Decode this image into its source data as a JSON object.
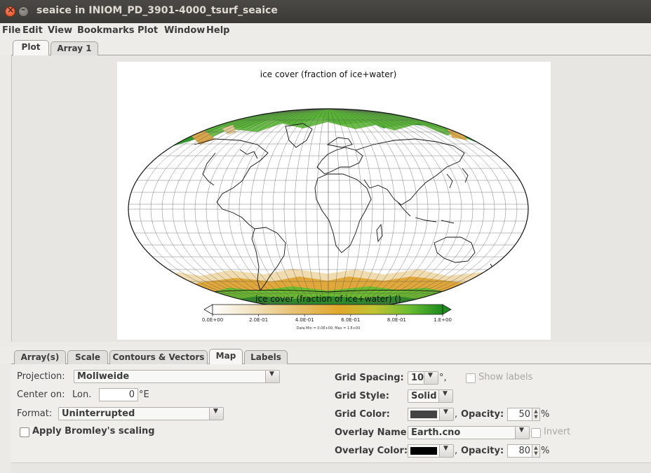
{
  "window": {
    "title": "seaice in INIOM_PD_3901-4000_tsurf_seaice"
  },
  "menu": [
    "File",
    "Edit",
    "View",
    "Bookmarks",
    "Plot",
    "Window",
    "Help"
  ],
  "top_tabs": [
    "Plot",
    "Array 1"
  ],
  "plot": {
    "title": "ice cover (fraction of ice+water)",
    "colorbar": {
      "label": "ice cover (fraction of ice+water) ()",
      "ticks": [
        "0.0E+00",
        "2.0E-01",
        "4.0E-01",
        "6.0E-01",
        "8.0E-01",
        "1.E+00"
      ],
      "stats": "Data Min = 0.0E+00, Max = 1.E+00",
      "colors": [
        "#ffffff",
        "#f0e0c0",
        "#e8c070",
        "#e0a530",
        "#c8c030",
        "#70c030",
        "#1e8c1e"
      ]
    }
  },
  "lower_tabs": [
    "Array(s)",
    "Scale",
    "Contours & Vectors",
    "Map",
    "Labels"
  ],
  "map_settings": {
    "projection_label": "Projection:",
    "projection_value": "Mollweide",
    "center_label": "Center on:",
    "lon_label": "Lon.",
    "lon_value": "0",
    "lon_unit": "°E",
    "format_label": "Format:",
    "format_value": "Uninterrupted",
    "bromley_label": "Apply Bromley's scaling",
    "grid_spacing_label": "Grid Spacing:",
    "grid_spacing_value": "10",
    "grid_spacing_unit": "°,",
    "show_labels": "Show labels",
    "grid_style_label": "Grid Style:",
    "grid_style_value": "Solid",
    "grid_color_label": "Grid Color:",
    "grid_color": "#444444",
    "opacity_label": "Opacity:",
    "grid_opacity": "50",
    "overlay_name_label": "Overlay Name:",
    "overlay_name_value": "Earth.cno",
    "invert_label": "Invert",
    "overlay_color_label": "Overlay Color:",
    "overlay_color": "#000000",
    "overlay_opacity": "80",
    "percent": "%",
    "comma": ","
  }
}
